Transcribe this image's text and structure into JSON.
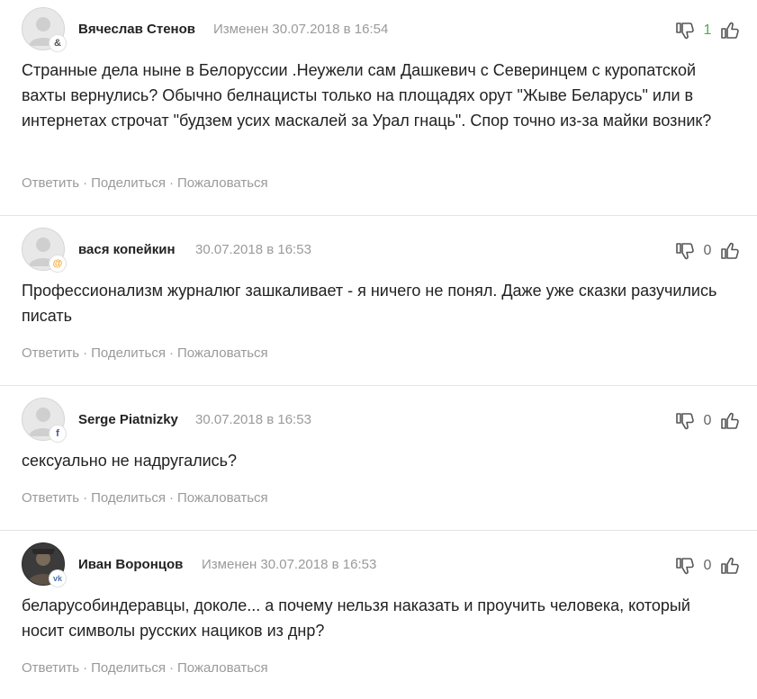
{
  "actions": {
    "reply": "Ответить",
    "share": "Поделиться",
    "report": "Пожаловаться",
    "separator": "·"
  },
  "comments": [
    {
      "author": "Вячеслав Стенов",
      "meta": "Изменен 30.07.2018 в 16:54",
      "source_icon": "link-icon",
      "source_glyph": "&",
      "source_color": "#555555",
      "votes": "1",
      "text": "Странные дела ныне в Белоруссии .Неужели сам Дашкевич с Северинцем с куропатской вахты вернулись? Обычно белнацисты только на площадях орут \"Жыве Беларусь\" или в интернетах строчат \"будзем усих маскалей за Урал гнаць\". Спор точно из-за майки возник?"
    },
    {
      "author": "вася копейкин",
      "meta": "30.07.2018 в 16:53",
      "source_icon": "email-icon",
      "source_glyph": "@",
      "source_color": "#f5a623",
      "votes": "0",
      "text": "Профессионализм журналюг зашкаливает - я ничего не понял. Даже уже сказки разучились писать"
    },
    {
      "author": "Serge Piatnizky",
      "meta": "30.07.2018 в 16:53",
      "source_icon": "facebook-icon",
      "source_glyph": "f",
      "source_color": "#3b5998",
      "votes": "0",
      "text": "сексуально не надругались?"
    },
    {
      "author": "Иван Воронцов",
      "meta": "Изменен 30.07.2018 в 16:53",
      "source_icon": "vk-icon",
      "source_glyph": "vk",
      "source_color": "#4a76a8",
      "votes": "0",
      "text": "беларусобиндеравцы, доколе... а почему нельзя наказать и проучить человека, который носит символы русских нациков из днр?"
    }
  ],
  "colors": {
    "positive_votes": "#4caf50",
    "neutral_votes": "#666666",
    "muted_text": "#9a9a9a",
    "divider": "#e3e3e3"
  }
}
